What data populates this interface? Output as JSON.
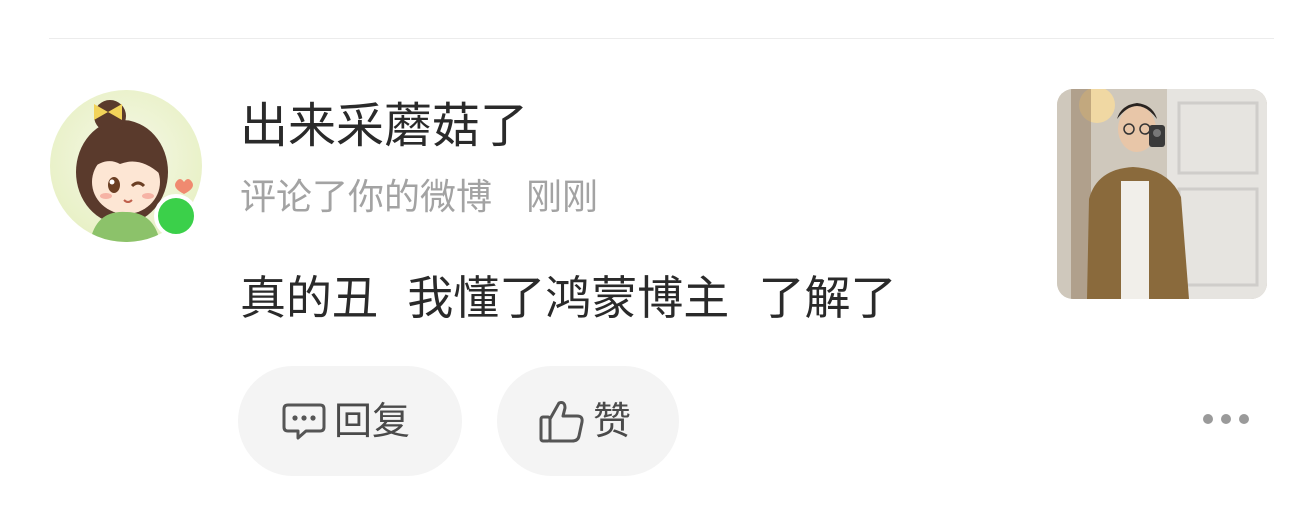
{
  "comment_item": {
    "username": "出来采蘑菇了",
    "action": "评论了你的微博",
    "time": "刚刚",
    "text": "真的丑  我懂了鸿蒙博主  了解了"
  },
  "actions": {
    "reply_label": "回复",
    "like_label": "赞"
  },
  "icons": {
    "reply": "comment-bubble-icon",
    "like": "thumbs-up-icon",
    "more": "more-dots-icon"
  },
  "colors": {
    "online_status": "#3bd04a",
    "pill_background": "#f4f4f4",
    "secondary_text": "#a3a3a3"
  }
}
